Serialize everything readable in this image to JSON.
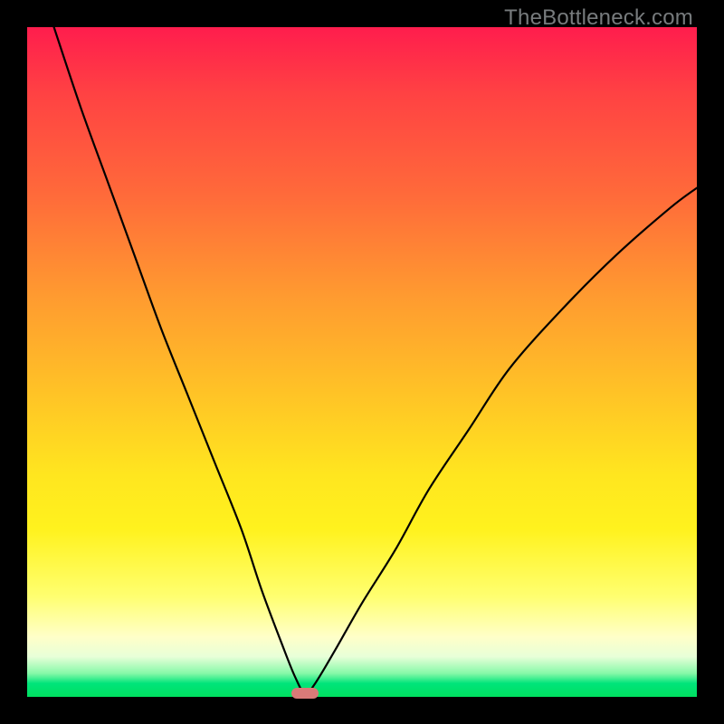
{
  "watermark": "TheBottleneck.com",
  "colors": {
    "frame": "#000000",
    "watermark": "#777b7d",
    "curve": "#000000",
    "dip_marker": "#d97a78",
    "gradient_stops": [
      "#ff1d4d",
      "#ff4243",
      "#ff6a3a",
      "#ff9a30",
      "#ffc426",
      "#ffe61f",
      "#fff21e",
      "#ffff70",
      "#ffffc8",
      "#e8ffd8",
      "#86f9a8",
      "#00e47a",
      "#00e060"
    ]
  },
  "chart_data": {
    "type": "line",
    "title": "",
    "xlabel": "",
    "ylabel": "",
    "xlim": [
      0,
      100
    ],
    "ylim": [
      0,
      100
    ],
    "legend": false,
    "grid": false,
    "series": [
      {
        "name": "bottleneck-curve",
        "x": [
          4,
          8,
          12,
          16,
          20,
          24,
          28,
          32,
          35,
          38,
          40,
          41.5,
          43,
          46,
          50,
          55,
          60,
          66,
          72,
          80,
          88,
          96,
          100
        ],
        "values": [
          100,
          88,
          77,
          66,
          55,
          45,
          35,
          25,
          16,
          8,
          3,
          0.5,
          2,
          7,
          14,
          22,
          31,
          40,
          49,
          58,
          66,
          73,
          76
        ]
      }
    ],
    "annotations": [
      {
        "name": "dip-marker",
        "x": 41.5,
        "y": 0.5,
        "shape": "rounded-rect",
        "color": "#d97a78"
      }
    ],
    "background": {
      "type": "vertical-gradient",
      "from": "#ff1d4d",
      "to": "#00e060"
    }
  }
}
